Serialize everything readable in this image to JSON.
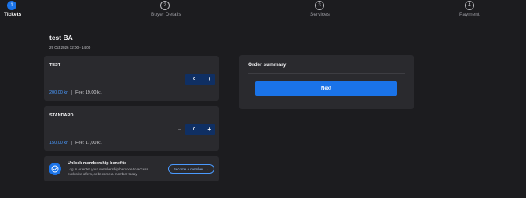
{
  "stepper": {
    "steps": [
      {
        "number": "1",
        "label": "Tickets"
      },
      {
        "number": "2",
        "label": "Buyer Details"
      },
      {
        "number": "3",
        "label": "Services"
      },
      {
        "number": "4",
        "label": "Payment"
      }
    ],
    "active_step": 1
  },
  "event": {
    "title": "test BA",
    "date": "29 Oct 2026 12:00 - 14:00"
  },
  "tickets": [
    {
      "name": "TEST",
      "quantity": "0",
      "price": "200,00 kr.",
      "fee": "Fee: 19,00 kr."
    },
    {
      "name": "STANDARD",
      "quantity": "0",
      "price": "150,00 kr.",
      "fee": "Fee: 17,00 kr."
    }
  ],
  "qty_controls": {
    "minus": "−",
    "plus": "+"
  },
  "membership": {
    "title": "Unlock membership benefits",
    "description": "Log in or enter your membership barcode to access exclusive offers, or become a member today.",
    "button_label": "Become a member",
    "button_arrow": "→"
  },
  "summary": {
    "title": "Order summary",
    "next_label": "Next"
  },
  "colors": {
    "accent": "#1a73e8",
    "price": "#4a9aff",
    "background": "#1c1c1f",
    "card": "#2a2a2e"
  },
  "icons": {
    "membership": "check-badge-icon",
    "button_arrow": "arrow-right-icon"
  }
}
